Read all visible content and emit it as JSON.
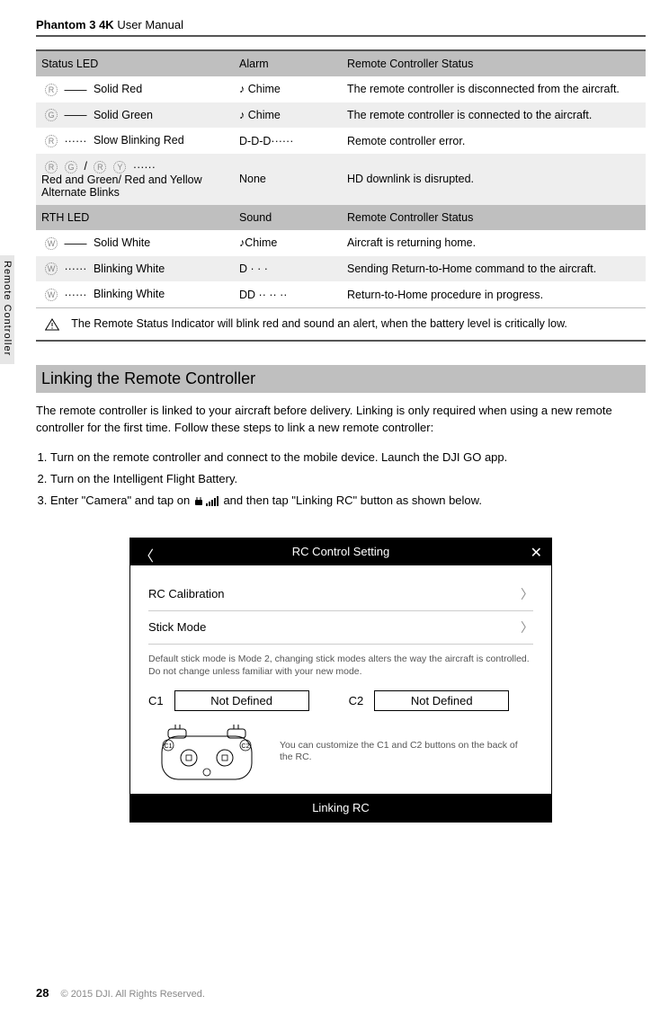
{
  "header": {
    "product": "Phantom 3 4K",
    "doc": "User Manual"
  },
  "sideTab": "Remote Controller",
  "table": {
    "header1": {
      "c1": "Status LED",
      "c2": "Alarm",
      "c3": "Remote Controller Status"
    },
    "rows1": [
      {
        "led": "R",
        "pattern": "——",
        "label": "Solid Red",
        "alarm_icon": "♪",
        "alarm": " Chime",
        "status": "The remote controller is disconnected from the aircraft.",
        "alt": false
      },
      {
        "led": "G",
        "pattern": "——",
        "label": "Solid Green",
        "alarm_icon": "♪",
        "alarm": " Chime",
        "status": "The remote controller is connected to the aircraft.",
        "alt": true
      },
      {
        "led": "R",
        "pattern": "······",
        "label": "Slow Blinking Red",
        "alarm_icon": "",
        "alarm": "D-D-D······",
        "status": "Remote controller error.",
        "alt": false
      },
      {
        "led_multi": "R G / R Y",
        "pattern": "······",
        "label": "Red and Green/ Red and Yellow Alternate Blinks",
        "alarm_icon": "",
        "alarm": "None",
        "status": "HD downlink is disrupted.",
        "alt": true,
        "multi": true
      }
    ],
    "header2": {
      "c1": "RTH LED",
      "c2": "Sound",
      "c3": "Remote Controller Status"
    },
    "rows2": [
      {
        "led": "W",
        "pattern": "——",
        "label": "Solid White",
        "alarm_icon": "♪",
        "alarm": "Chime",
        "status": "Aircraft is returning home.",
        "alt": false
      },
      {
        "led": "W",
        "pattern": "······",
        "label": "Blinking White",
        "alarm_icon": "",
        "alarm": "D · · ·",
        "status": "Sending Return-to-Home command to the aircraft.",
        "alt": true
      },
      {
        "led": "W",
        "pattern": "······",
        "label": "Blinking White",
        "alarm_icon": "",
        "alarm": "DD ·· ·· ··",
        "status": "Return-to-Home procedure in progress.",
        "alt": false
      }
    ],
    "warning": "The Remote Status Indicator will blink red and sound an alert, when the battery level is critically low."
  },
  "section": {
    "title": "Linking the Remote Controller",
    "intro": "The remote controller is linked to your aircraft before delivery. Linking is only required when using a new remote controller for the first time. Follow these steps to link a new remote controller:",
    "steps": {
      "s1": "Turn on the remote controller and connect to the mobile device. Launch the DJI GO app.",
      "s2": "Turn on the Intelligent Flight Battery.",
      "s3a": "Enter \"Camera\" and tap on ",
      "s3b": " and then tap \"Linking RC\"  button as shown below."
    }
  },
  "rcPanel": {
    "title": "RC Control Setting",
    "row1": "RC Calibration",
    "row2": "Stick Mode",
    "note": "Default stick mode is Mode 2, changing stick modes alters the way the aircraft is controlled. Do not change unless familiar with your new mode.",
    "c1label": "C1",
    "c1value": "Not Defined",
    "c2label": "C2",
    "c2value": "Not Defined",
    "diagramNote": "You can customize the C1 and C2 buttons on the back of the RC.",
    "footer": "Linking RC"
  },
  "footer": {
    "page": "28",
    "copyright": "© 2015 DJI. All Rights Reserved."
  }
}
